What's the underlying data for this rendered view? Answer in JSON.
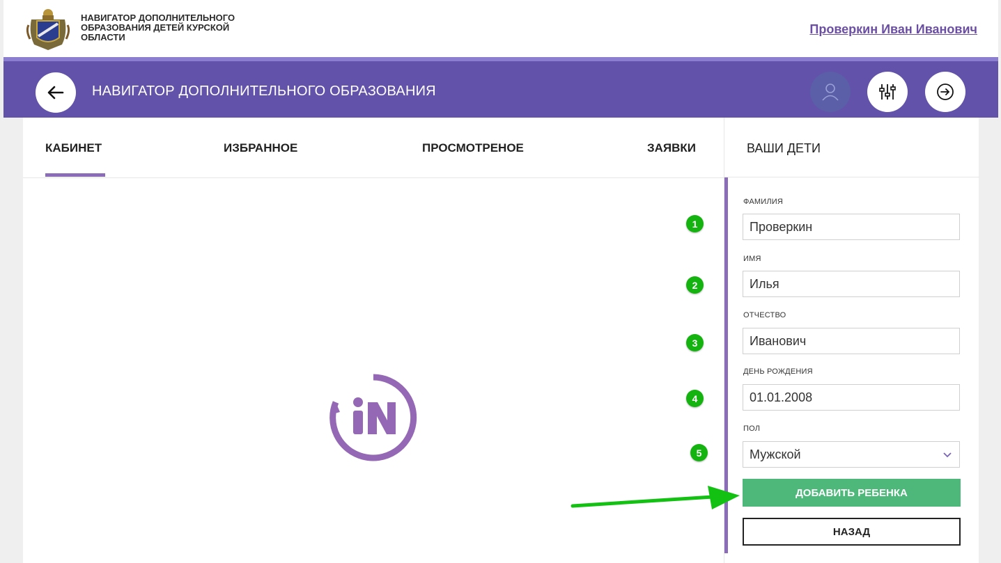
{
  "header": {
    "site_title_lines": [
      "НАВИГАТОР ДОПОЛНИТЕЛЬНОГО",
      "ОБРАЗОВАНИЯ ДЕТЕЙ КУРСКОЙ",
      "ОБЛАСТИ"
    ],
    "user_name": "Проверкин Иван Иванович"
  },
  "navbar": {
    "title": "НАВИГАТОР ДОПОЛНИТЕЛЬНОГО ОБРАЗОВАНИЯ",
    "icons": [
      "arrow-left-icon",
      "user-icon",
      "sliders-icon",
      "arrow-right-circle-icon"
    ]
  },
  "tabs": [
    {
      "label": "КАБИНЕТ",
      "active": true
    },
    {
      "label": "ИЗБРАННОЕ",
      "active": false
    },
    {
      "label": "ПРОСМОТРЕНОЕ",
      "active": false
    },
    {
      "label": "ЗАЯВКИ",
      "active": false
    }
  ],
  "sidebar": {
    "title": "ВАШИ ДЕТИ",
    "fields": [
      {
        "label": "ФАМИЛИЯ",
        "value": "Проверкин",
        "step": "1"
      },
      {
        "label": "ИМЯ",
        "value": "Илья",
        "step": "2"
      },
      {
        "label": "ОТЧЕСТВО",
        "value": "Иванович",
        "step": "3"
      },
      {
        "label": "ДЕНЬ РОЖДЕНИЯ",
        "value": "01.01.2008",
        "step": "4"
      },
      {
        "label": "ПОЛ",
        "value": "Мужской",
        "step": "5"
      }
    ],
    "add_button": "ДОБАВИТЬ РЕБЕНКА",
    "back_button": "НАЗАД"
  },
  "colors": {
    "brand_purple": "#6352aa",
    "accent_purple": "#8a6cb8",
    "add_button_green": "#4db879",
    "annotation_green": "#15b30f"
  }
}
